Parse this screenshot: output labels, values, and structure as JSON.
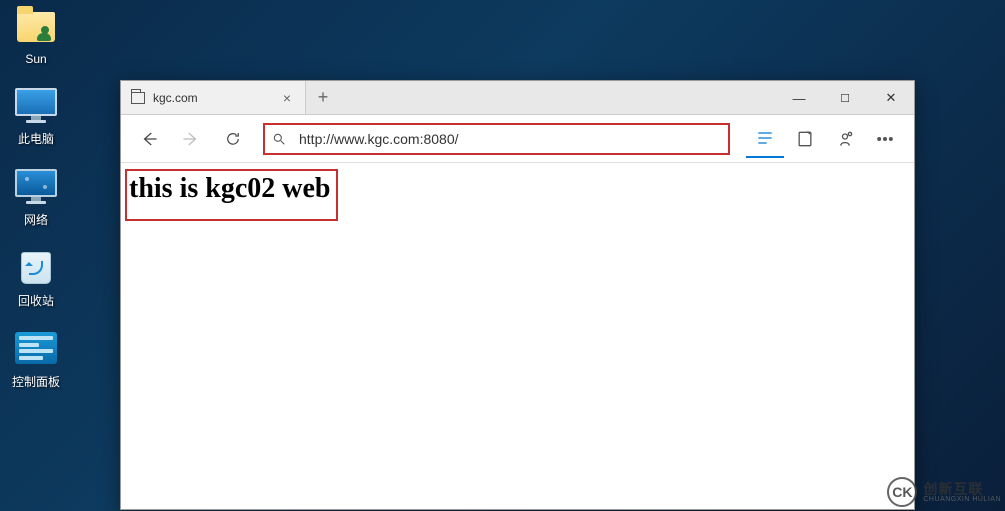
{
  "desktop": {
    "icons": [
      {
        "name": "folder-sun",
        "label": "Sun"
      },
      {
        "name": "this-pc",
        "label": "此电脑"
      },
      {
        "name": "network",
        "label": "网络"
      },
      {
        "name": "recycle-bin",
        "label": "回收站"
      },
      {
        "name": "control-panel",
        "label": "控制面板"
      }
    ]
  },
  "browser": {
    "tab": {
      "title": "kgc.com"
    },
    "address_value": "http://www.kgc.com:8080/",
    "page_heading": "this is kgc02 web"
  },
  "watermark": {
    "logo_text": "CK",
    "cn": "创新互联",
    "en": "CHUANGXIN HULIAN"
  }
}
